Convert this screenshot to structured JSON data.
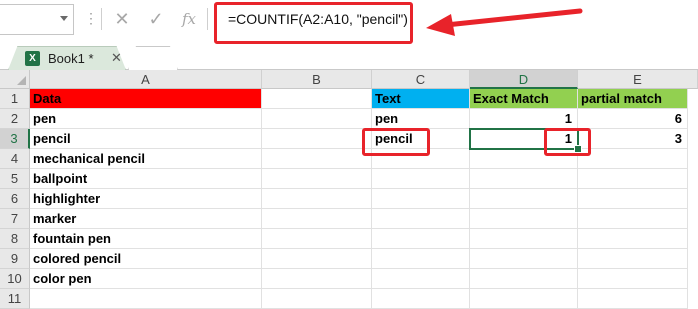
{
  "formula_bar": {
    "name_box_value": "",
    "options_dots": "⋮",
    "cancel_icon": "✕",
    "enter_icon": "✓",
    "fx_label": "fx",
    "formula": "=COUNTIF(A2:A10, \"pencil\")"
  },
  "tabs": {
    "workbook_label": "Book1 *",
    "close_glyph": "✕",
    "icon_letter": "X"
  },
  "columns": [
    "A",
    "B",
    "C",
    "D",
    "E"
  ],
  "rows": [
    "1",
    "2",
    "3",
    "4",
    "5",
    "6",
    "7",
    "8",
    "9",
    "10",
    "11"
  ],
  "cells": {
    "A1": "Data",
    "C1": "Text",
    "D1": "Exact Match",
    "E1": "partial match",
    "A2": "pen",
    "C2": "pen",
    "D2": "1",
    "E2": "6",
    "A3": "pencil",
    "C3": "pencil",
    "D3": "1",
    "E3": "3",
    "A4": "mechanical pencil",
    "A5": "ballpoint",
    "A6": "highlighter",
    "A7": "marker",
    "A8": "fountain pen",
    "A9": "colored pencil",
    "A10": "color pen"
  },
  "active_cell": "D3",
  "colors": {
    "header_red": "#ff0000",
    "header_blue": "#00b0f0",
    "header_green": "#92d050",
    "annotation_red": "#e8232a",
    "excel_green": "#217346"
  }
}
